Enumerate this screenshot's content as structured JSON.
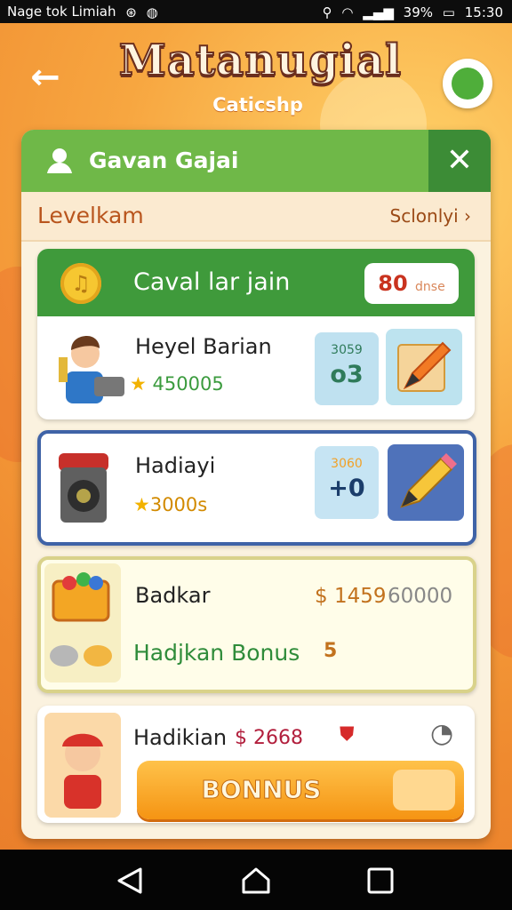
{
  "status_bar": {
    "carrier": "Nage tok Limiah",
    "battery": "39%",
    "time": "15:30"
  },
  "header": {
    "title": "Matanugial",
    "subtitle": "Caticshp"
  },
  "panel": {
    "tab_title": "Gavan Gajai",
    "level_label": "Levelkam",
    "sort_label": "Sclonlyi"
  },
  "cards": [
    {
      "title": "Caval lar jain",
      "badge_value": "80",
      "badge_unit": "dnse",
      "name": "Heyel Barian",
      "points": "450005",
      "tile_small": "3059",
      "tile_big": "o3"
    },
    {
      "name": "Hadiayi",
      "points": "3000s",
      "tile_small": "3060",
      "tile_big": "+0"
    },
    {
      "name": "Badkar",
      "price": "$ 1459",
      "price2": "60000",
      "bonus_text": "Hadjkan Bonus",
      "bonus_mark": "5"
    },
    {
      "name": "Hadikian",
      "price": "$ 2668",
      "button_label": "BONNUS"
    }
  ],
  "colors": {
    "accent_green": "#6fb848",
    "dark_green": "#3f9a3b",
    "orange": "#f59413",
    "blue_border": "#3f63a7"
  }
}
